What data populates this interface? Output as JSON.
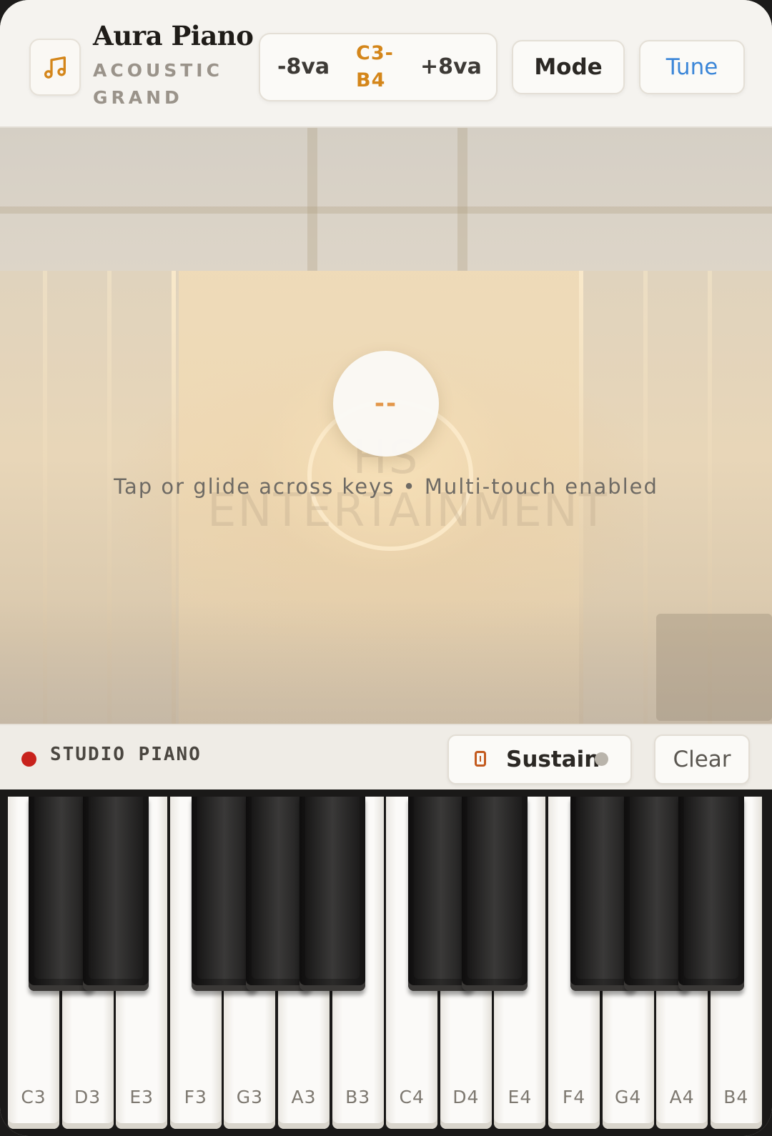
{
  "header": {
    "title": "Aura Piano",
    "subtitle": "ACOUSTIC GRAND",
    "logo_icon": "music-note-icon",
    "octave": {
      "down_label": "-8va",
      "range_label": "C3-B4",
      "up_label": "+8va"
    },
    "mode_label": "Mode",
    "tune_label": "Tune"
  },
  "stage": {
    "note_display": "--",
    "hint": "Tap or glide across keys • Multi-touch enabled",
    "background_text": "HS ENTERTAINMENT"
  },
  "status": {
    "label": "STUDIO PIANO",
    "sustain_label": "Sustain",
    "clear_label": "Clear",
    "sustain_icon": "pedal-icon"
  },
  "keyboard": {
    "white_keys": [
      "C3",
      "D3",
      "E3",
      "F3",
      "G3",
      "A3",
      "B3",
      "C4",
      "D4",
      "E4",
      "F4",
      "G4",
      "A4",
      "B4"
    ],
    "black_keys": [
      "C#3",
      "D#3",
      "F#3",
      "G#3",
      "A#3",
      "C#4",
      "D#4",
      "F#4",
      "G#4",
      "A#4"
    ]
  },
  "colors": {
    "accent": "#d4861a",
    "tune_blue": "#3b86d8",
    "record_red": "#c8221c"
  }
}
